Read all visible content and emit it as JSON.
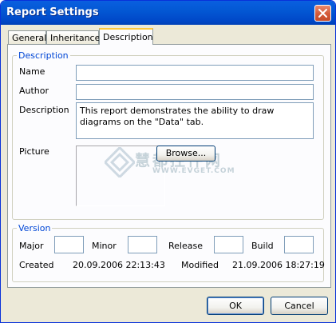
{
  "window": {
    "title": "Report Settings",
    "close_icon": "close-icon"
  },
  "tabs": [
    {
      "label": "General",
      "active": false
    },
    {
      "label": "Inheritance",
      "active": false
    },
    {
      "label": "Description",
      "active": true
    }
  ],
  "description_group": {
    "legend": "Description",
    "name_label": "Name",
    "name_value": "",
    "author_label": "Author",
    "author_value": "",
    "description_label": "Description",
    "description_value": "This report demonstrates the ability to draw diagrams on the \"Data\" tab.",
    "picture_label": "Picture",
    "browse_button": "Browse..."
  },
  "version_group": {
    "legend": "Version",
    "major_label": "Major",
    "major_value": "",
    "minor_label": "Minor",
    "minor_value": "",
    "release_label": "Release",
    "release_value": "",
    "build_label": "Build",
    "build_value": "",
    "created_label": "Created",
    "created_value": "20.09.2006 22:13:43",
    "modified_label": "Modified",
    "modified_value": "21.09.2006 18:27:19"
  },
  "buttons": {
    "ok": "OK",
    "cancel": "Cancel"
  },
  "watermark": {
    "text": "慧都控件网",
    "url": "WWW.EVGET.COM"
  },
  "colors": {
    "titlebar": "#0358d4",
    "group_legend": "#0046d5",
    "active_tab_accent": "#ffc83c"
  }
}
